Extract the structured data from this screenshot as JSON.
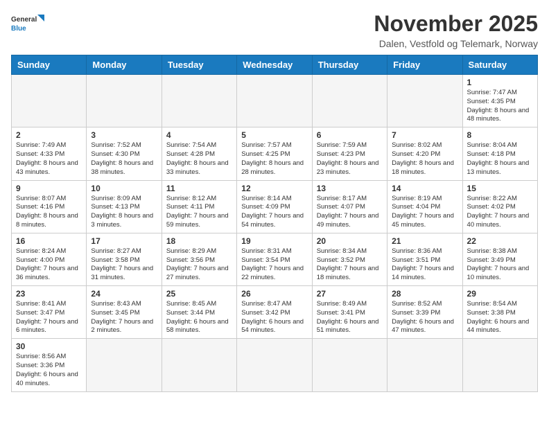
{
  "logo": {
    "text_general": "General",
    "text_blue": "Blue"
  },
  "header": {
    "month_year": "November 2025",
    "location": "Dalen, Vestfold og Telemark, Norway"
  },
  "days_of_week": [
    "Sunday",
    "Monday",
    "Tuesday",
    "Wednesday",
    "Thursday",
    "Friday",
    "Saturday"
  ],
  "weeks": [
    [
      {
        "day": "",
        "info": ""
      },
      {
        "day": "",
        "info": ""
      },
      {
        "day": "",
        "info": ""
      },
      {
        "day": "",
        "info": ""
      },
      {
        "day": "",
        "info": ""
      },
      {
        "day": "",
        "info": ""
      },
      {
        "day": "1",
        "info": "Sunrise: 7:47 AM\nSunset: 4:35 PM\nDaylight: 8 hours and 48 minutes."
      }
    ],
    [
      {
        "day": "2",
        "info": "Sunrise: 7:49 AM\nSunset: 4:33 PM\nDaylight: 8 hours and 43 minutes."
      },
      {
        "day": "3",
        "info": "Sunrise: 7:52 AM\nSunset: 4:30 PM\nDaylight: 8 hours and 38 minutes."
      },
      {
        "day": "4",
        "info": "Sunrise: 7:54 AM\nSunset: 4:28 PM\nDaylight: 8 hours and 33 minutes."
      },
      {
        "day": "5",
        "info": "Sunrise: 7:57 AM\nSunset: 4:25 PM\nDaylight: 8 hours and 28 minutes."
      },
      {
        "day": "6",
        "info": "Sunrise: 7:59 AM\nSunset: 4:23 PM\nDaylight: 8 hours and 23 minutes."
      },
      {
        "day": "7",
        "info": "Sunrise: 8:02 AM\nSunset: 4:20 PM\nDaylight: 8 hours and 18 minutes."
      },
      {
        "day": "8",
        "info": "Sunrise: 8:04 AM\nSunset: 4:18 PM\nDaylight: 8 hours and 13 minutes."
      }
    ],
    [
      {
        "day": "9",
        "info": "Sunrise: 8:07 AM\nSunset: 4:16 PM\nDaylight: 8 hours and 8 minutes."
      },
      {
        "day": "10",
        "info": "Sunrise: 8:09 AM\nSunset: 4:13 PM\nDaylight: 8 hours and 3 minutes."
      },
      {
        "day": "11",
        "info": "Sunrise: 8:12 AM\nSunset: 4:11 PM\nDaylight: 7 hours and 59 minutes."
      },
      {
        "day": "12",
        "info": "Sunrise: 8:14 AM\nSunset: 4:09 PM\nDaylight: 7 hours and 54 minutes."
      },
      {
        "day": "13",
        "info": "Sunrise: 8:17 AM\nSunset: 4:07 PM\nDaylight: 7 hours and 49 minutes."
      },
      {
        "day": "14",
        "info": "Sunrise: 8:19 AM\nSunset: 4:04 PM\nDaylight: 7 hours and 45 minutes."
      },
      {
        "day": "15",
        "info": "Sunrise: 8:22 AM\nSunset: 4:02 PM\nDaylight: 7 hours and 40 minutes."
      }
    ],
    [
      {
        "day": "16",
        "info": "Sunrise: 8:24 AM\nSunset: 4:00 PM\nDaylight: 7 hours and 36 minutes."
      },
      {
        "day": "17",
        "info": "Sunrise: 8:27 AM\nSunset: 3:58 PM\nDaylight: 7 hours and 31 minutes."
      },
      {
        "day": "18",
        "info": "Sunrise: 8:29 AM\nSunset: 3:56 PM\nDaylight: 7 hours and 27 minutes."
      },
      {
        "day": "19",
        "info": "Sunrise: 8:31 AM\nSunset: 3:54 PM\nDaylight: 7 hours and 22 minutes."
      },
      {
        "day": "20",
        "info": "Sunrise: 8:34 AM\nSunset: 3:52 PM\nDaylight: 7 hours and 18 minutes."
      },
      {
        "day": "21",
        "info": "Sunrise: 8:36 AM\nSunset: 3:51 PM\nDaylight: 7 hours and 14 minutes."
      },
      {
        "day": "22",
        "info": "Sunrise: 8:38 AM\nSunset: 3:49 PM\nDaylight: 7 hours and 10 minutes."
      }
    ],
    [
      {
        "day": "23",
        "info": "Sunrise: 8:41 AM\nSunset: 3:47 PM\nDaylight: 7 hours and 6 minutes."
      },
      {
        "day": "24",
        "info": "Sunrise: 8:43 AM\nSunset: 3:45 PM\nDaylight: 7 hours and 2 minutes."
      },
      {
        "day": "25",
        "info": "Sunrise: 8:45 AM\nSunset: 3:44 PM\nDaylight: 6 hours and 58 minutes."
      },
      {
        "day": "26",
        "info": "Sunrise: 8:47 AM\nSunset: 3:42 PM\nDaylight: 6 hours and 54 minutes."
      },
      {
        "day": "27",
        "info": "Sunrise: 8:49 AM\nSunset: 3:41 PM\nDaylight: 6 hours and 51 minutes."
      },
      {
        "day": "28",
        "info": "Sunrise: 8:52 AM\nSunset: 3:39 PM\nDaylight: 6 hours and 47 minutes."
      },
      {
        "day": "29",
        "info": "Sunrise: 8:54 AM\nSunset: 3:38 PM\nDaylight: 6 hours and 44 minutes."
      }
    ],
    [
      {
        "day": "30",
        "info": "Sunrise: 8:56 AM\nSunset: 3:36 PM\nDaylight: 6 hours and 40 minutes."
      },
      {
        "day": "",
        "info": ""
      },
      {
        "day": "",
        "info": ""
      },
      {
        "day": "",
        "info": ""
      },
      {
        "day": "",
        "info": ""
      },
      {
        "day": "",
        "info": ""
      },
      {
        "day": "",
        "info": ""
      }
    ]
  ]
}
